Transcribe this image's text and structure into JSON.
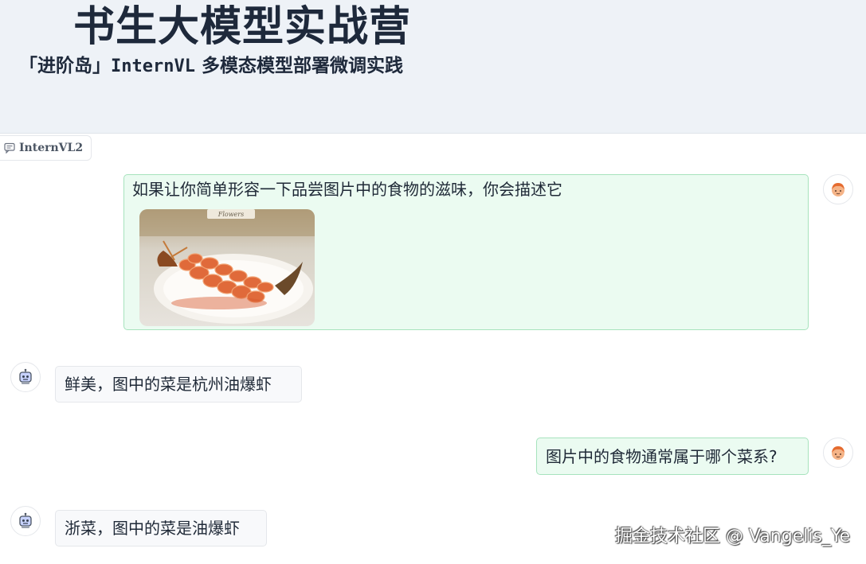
{
  "header": {
    "title": "书生大模型实战营",
    "subtitle_prefix": "「进阶岛」",
    "subtitle_mono": "InternVL",
    "subtitle_suffix": " 多模态模型部署微调实践"
  },
  "chatbot": {
    "label": "InternVL2"
  },
  "messages": [
    {
      "role": "user",
      "text": "如果让你简单形容一下品尝图片中的食物的滋味，你会描述它",
      "has_image": true,
      "image_caption": "Flowers"
    },
    {
      "role": "assistant",
      "text": "鲜美，图中的菜是杭州油爆虾"
    },
    {
      "role": "user",
      "text": "图片中的食物通常属于哪个菜系?"
    },
    {
      "role": "assistant",
      "text": "浙菜，图中的菜是油爆虾"
    }
  ],
  "watermark": "掘金技术社区 @ Vangelis_Ye",
  "colors": {
    "header_bg": "#eef2f7",
    "user_bubble_bg": "#ebfbf1",
    "user_bubble_border": "#a7e3bd",
    "bot_bubble_bg": "#f8f9fb"
  }
}
